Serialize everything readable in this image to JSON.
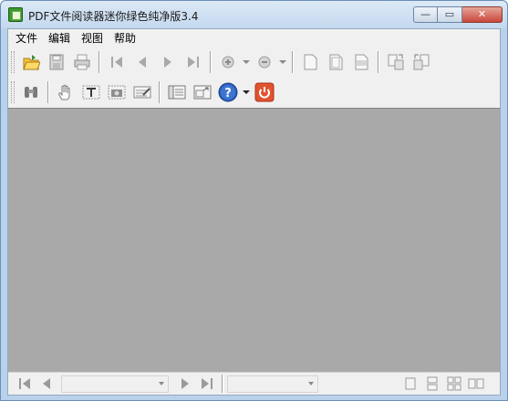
{
  "window": {
    "title": "PDF文件阅读器迷你绿色纯净版3.4",
    "minimize_glyph": "—",
    "maximize_glyph": "▭",
    "close_glyph": "✕"
  },
  "menu": {
    "items": [
      "文件",
      "编辑",
      "视图",
      "帮助"
    ]
  },
  "toolbar1": {
    "buttons": [
      "open-icon",
      "save-icon",
      "print-icon",
      "first-page-icon",
      "previous-page-icon",
      "next-page-icon",
      "last-page-icon",
      "zoom-in-icon",
      "zoom-in-dropdown",
      "zoom-out-icon",
      "zoom-out-dropdown",
      "single-page-icon",
      "fit-page-icon",
      "fit-width-icon",
      "rotate-clockwise-icon",
      "rotate-counterclockwise-icon"
    ]
  },
  "toolbar2": {
    "buttons": [
      "find-icon",
      "hand-tool-icon",
      "text-select-icon",
      "snapshot-icon",
      "annotate-icon",
      "bookmarks-panel-icon",
      "fullscreen-icon",
      "help-icon",
      "help-dropdown",
      "exit-icon"
    ]
  },
  "statusbar": {
    "page_value": "",
    "zoom_value": "",
    "buttons": [
      "first-page-icon",
      "previous-page-icon",
      "next-page-icon",
      "last-page-icon",
      "single-page-view-icon",
      "continuous-view-icon",
      "facing-view-icon",
      "continuous-facing-view-icon"
    ]
  },
  "colors": {
    "document_area": "#a9a9a9",
    "help_blue": "#2d5fb8",
    "exit_red": "#e0532f"
  }
}
